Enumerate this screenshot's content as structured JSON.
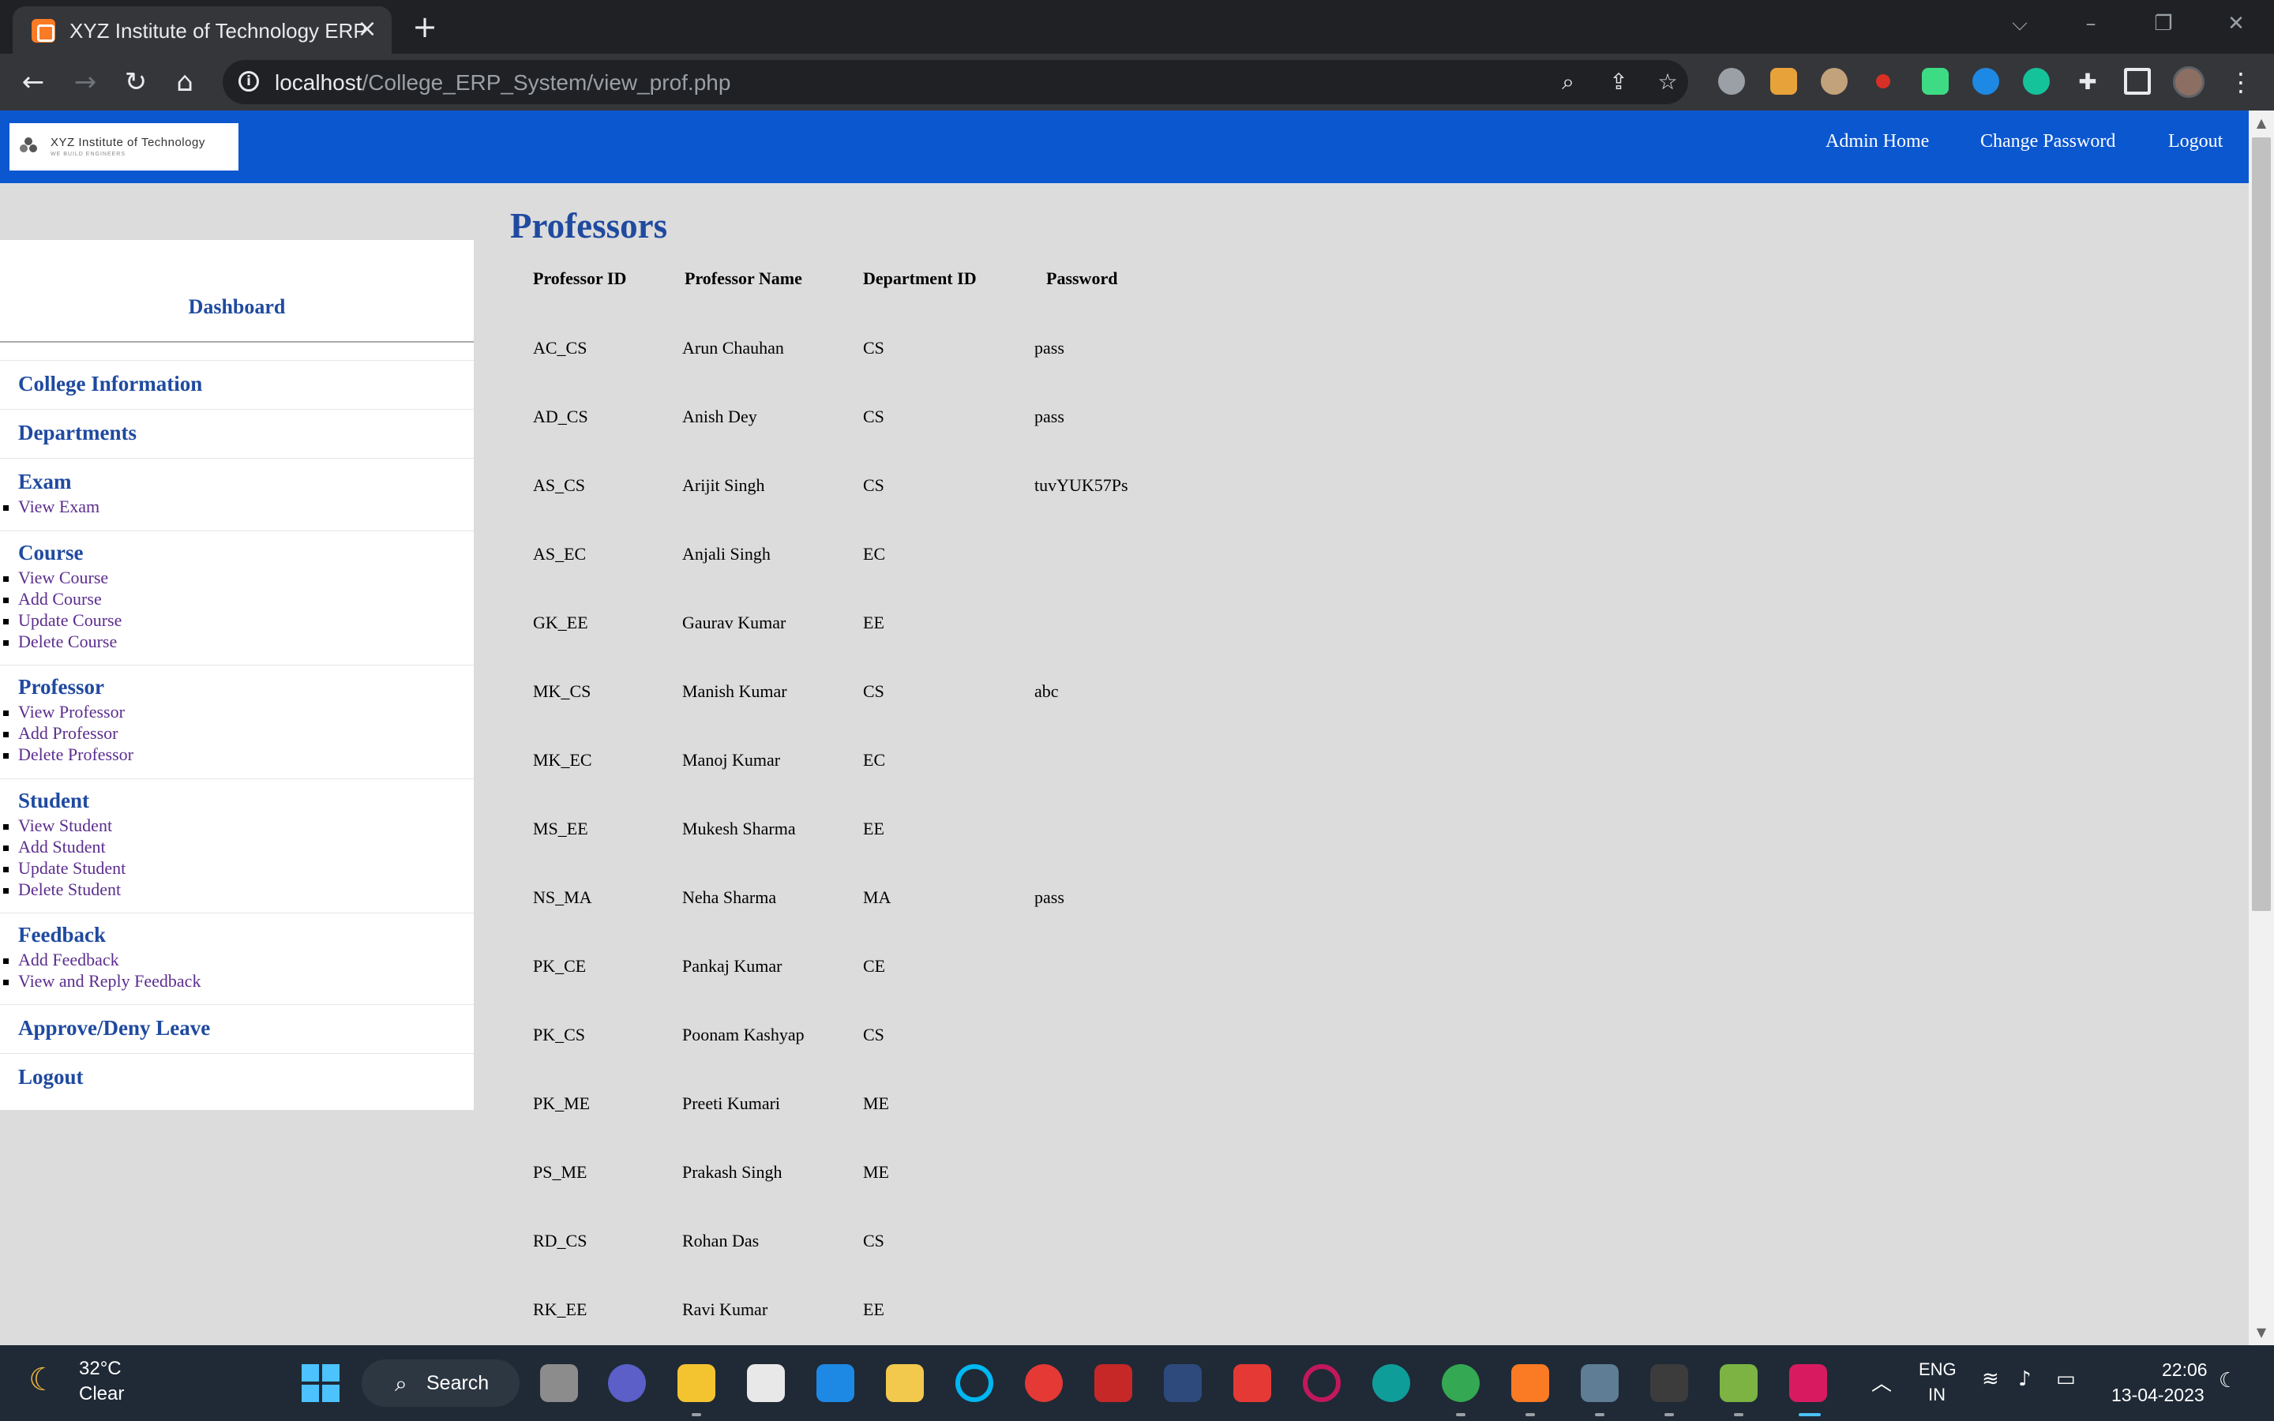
{
  "browser": {
    "tab_title": "XYZ Institute of Technology ERP",
    "url_host": "localhost",
    "url_path": "/College_ERP_System/view_prof.php",
    "icons": [
      "xampp-icon",
      "close-icon",
      "new-tab-icon",
      "back-icon",
      "forward-icon",
      "reload-icon",
      "home-icon",
      "info-icon",
      "zoom-icon",
      "share-icon",
      "star-icon",
      "extensions-icon",
      "sidebar-icon",
      "menu-icon"
    ]
  },
  "site": {
    "logo_text": "XYZ Institute of Technology",
    "logo_tagline": "WE BUILD ENGINEERS",
    "nav": {
      "admin_home": "Admin Home",
      "change_password": "Change Password",
      "logout": "Logout"
    }
  },
  "sidebar": {
    "dashboard": "Dashboard",
    "college_info": "College Information",
    "departments": "Departments",
    "exam": {
      "label": "Exam",
      "links": [
        "View Exam"
      ]
    },
    "course": {
      "label": "Course",
      "links": [
        "View Course",
        "Add Course",
        "Update Course",
        "Delete Course"
      ]
    },
    "professor": {
      "label": "Professor",
      "links": [
        "View Professor",
        "Add Professor",
        "Delete Professor"
      ]
    },
    "student": {
      "label": "Student",
      "links": [
        "View Student",
        "Add Student",
        "Update Student",
        "Delete Student"
      ]
    },
    "feedback": {
      "label": "Feedback",
      "links": [
        "Add Feedback",
        "View and Reply Feedback"
      ]
    },
    "leave": "Approve/Deny Leave",
    "logout": "Logout"
  },
  "main": {
    "title": "Professors",
    "columns": [
      "Professor ID",
      "Professor Name",
      "Department ID",
      "Password"
    ],
    "rows": [
      [
        "AC_CS",
        "Arun Chauhan",
        "CS",
        "pass"
      ],
      [
        "AD_CS",
        "Anish Dey",
        "CS",
        "pass"
      ],
      [
        "AS_CS",
        "Arijit Singh",
        "CS",
        "tuvYUK57Ps"
      ],
      [
        "AS_EC",
        "Anjali Singh",
        "EC",
        ""
      ],
      [
        "GK_EE",
        "Gaurav Kumar",
        "EE",
        ""
      ],
      [
        "MK_CS",
        "Manish Kumar",
        "CS",
        "abc"
      ],
      [
        "MK_EC",
        "Manoj Kumar",
        "EC",
        ""
      ],
      [
        "MS_EE",
        "Mukesh Sharma",
        "EE",
        ""
      ],
      [
        "NS_MA",
        "Neha Sharma",
        "MA",
        "pass"
      ],
      [
        "PK_CE",
        "Pankaj Kumar",
        "CE",
        ""
      ],
      [
        "PK_CS",
        "Poonam Kashyap",
        "CS",
        ""
      ],
      [
        "PK_ME",
        "Preeti Kumari",
        "ME",
        ""
      ],
      [
        "PS_ME",
        "Prakash Singh",
        "ME",
        ""
      ],
      [
        "RD_CS",
        "Rohan Das",
        "CS",
        ""
      ],
      [
        "RK_EE",
        "Ravi Kumar",
        "EE",
        ""
      ]
    ]
  },
  "taskbar": {
    "temperature": "32°C",
    "condition": "Clear",
    "search_label": "Search",
    "lang_top": "ENG",
    "lang_bottom": "IN",
    "time": "22:06",
    "date": "13-04-2023"
  },
  "colors": {
    "header_blue": "#0b57d0",
    "link_blue": "#1f4aa0",
    "visited_purple": "#5b2d8e",
    "page_bg": "#dcdcdc"
  }
}
